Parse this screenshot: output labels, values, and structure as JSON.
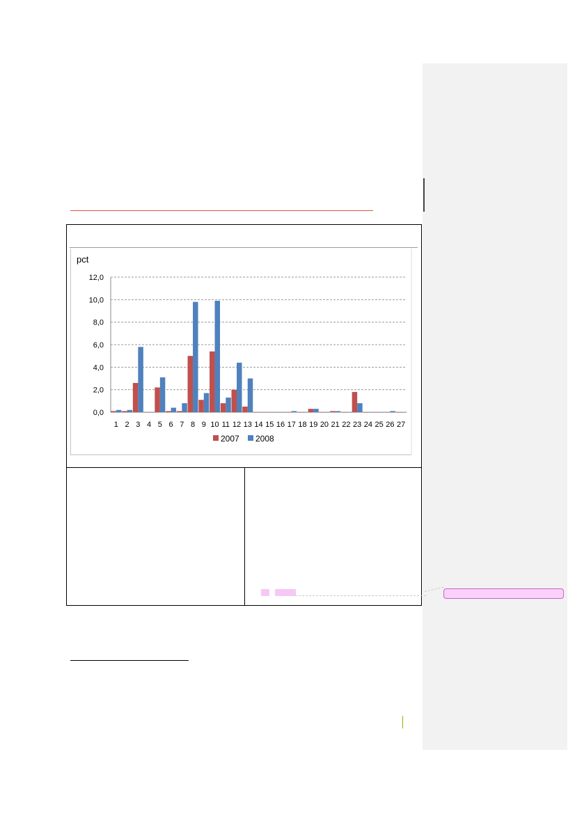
{
  "chart_data": {
    "type": "bar",
    "ylabel": "pct",
    "ylim": [
      0,
      12
    ],
    "yticks": [
      "0,0",
      "2,0",
      "4,0",
      "6,0",
      "8,0",
      "10,0",
      "12,0"
    ],
    "ytick_values": [
      0,
      2,
      4,
      6,
      8,
      10,
      12
    ],
    "grid": true,
    "legend_position": "bottom",
    "categories": [
      "1",
      "2",
      "3",
      "4",
      "5",
      "6",
      "7",
      "8",
      "9",
      "10",
      "11",
      "12",
      "13",
      "14",
      "15",
      "16",
      "17",
      "18",
      "19",
      "20",
      "21",
      "22",
      "23",
      "24",
      "25",
      "26",
      "27"
    ],
    "series": [
      {
        "name": "2007",
        "color": "#c0504d",
        "values": [
          0.1,
          0.1,
          2.6,
          0.0,
          2.2,
          0.1,
          0.1,
          5.0,
          1.1,
          5.4,
          0.8,
          2.0,
          0.5,
          0.0,
          0.0,
          0.0,
          0.0,
          0.0,
          0.3,
          0.0,
          0.1,
          0.0,
          1.8,
          0.0,
          0.0,
          0.0,
          0.0
        ]
      },
      {
        "name": "2008",
        "color": "#4f81bd",
        "values": [
          0.2,
          0.2,
          5.8,
          0.0,
          3.1,
          0.4,
          0.8,
          9.8,
          1.7,
          9.9,
          1.3,
          4.4,
          3.0,
          0.0,
          0.0,
          0.0,
          0.1,
          0.0,
          0.3,
          0.0,
          0.1,
          0.0,
          0.8,
          0.0,
          0.0,
          0.1,
          0.0
        ]
      }
    ]
  }
}
